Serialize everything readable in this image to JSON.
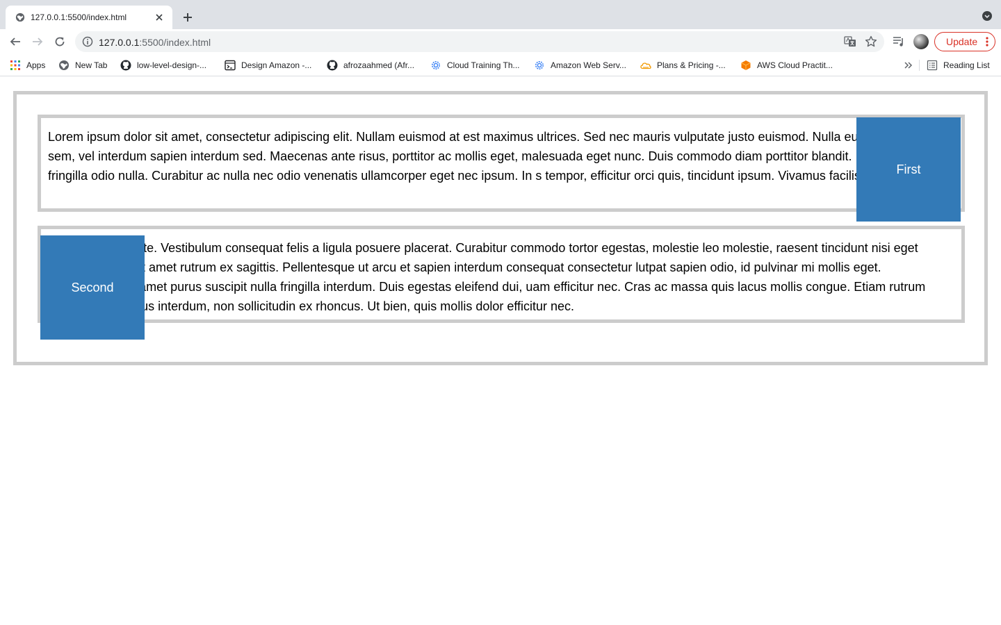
{
  "browser": {
    "tab_title": "127.0.0.1:5500/index.html",
    "url_host": "127.0.0.1",
    "url_rest": ":5500/index.html",
    "update_label": "Update",
    "accent_update": "#d93025"
  },
  "bookmarks": [
    {
      "label": "Apps",
      "icon": "apps-grid-icon"
    },
    {
      "label": "New Tab",
      "icon": "globe-icon"
    },
    {
      "label": "low-level-design-...",
      "icon": "github-icon"
    },
    {
      "label": "Design Amazon -...",
      "icon": "terminal-icon"
    },
    {
      "label": "afrozaahmed (Afr...",
      "icon": "github-icon"
    },
    {
      "label": "Cloud Training Th...",
      "icon": "cloud-gear-icon"
    },
    {
      "label": "Amazon Web Serv...",
      "icon": "cloud-gear-icon"
    },
    {
      "label": "Plans & Pricing -...",
      "icon": "cloud-outline-icon"
    },
    {
      "label": "AWS Cloud Practit...",
      "icon": "aws-cube-icon"
    }
  ],
  "reading_list_label": "Reading List",
  "page": {
    "box1_text": "Lorem ipsum dolor sit amet, consectetur adipiscing elit. Nullam euismod at est maximus ultrices. Sed nec mauris vulputate justo euismod. Nulla euismod posuere sem, vel interdum sapien interdum sed. Maecenas ante risus, porttitor ac mollis eget, malesuada eget nunc. Duis commodo diam porttitor blandit. Pellentesque fringilla odio nulla. Curabitur ac nulla nec odio venenatis ullamcorper eget nec ipsum. In s tempor, efficitur orci quis, tincidunt ipsum. Vivamus facilisis auctor ligula.",
    "box2_text": "nsectetur vulputate. Vestibulum consequat felis a ligula posuere placerat. Curabitur commodo tortor egestas, molestie leo molestie, raesent tincidunt nisi eget turpis tristique, sit amet rutrum ex sagittis. Pellentesque ut arcu et sapien interdum consequat consectetur lutpat sapien odio, id pulvinar mi mollis eget. Suspendisse sit amet purus suscipit nulla fringilla interdum. Duis egestas eleifend dui, uam efficitur nec. Cras ac massa quis lacus mollis congue. Etiam rutrum odio sodales lectus interdum, non sollicitudin ex rhoncus. Ut bien, quis mollis dolor efficitur nec.",
    "first_label": "First",
    "second_label": "Second",
    "square_color": "#337ab7",
    "border_color": "#cccccc"
  }
}
